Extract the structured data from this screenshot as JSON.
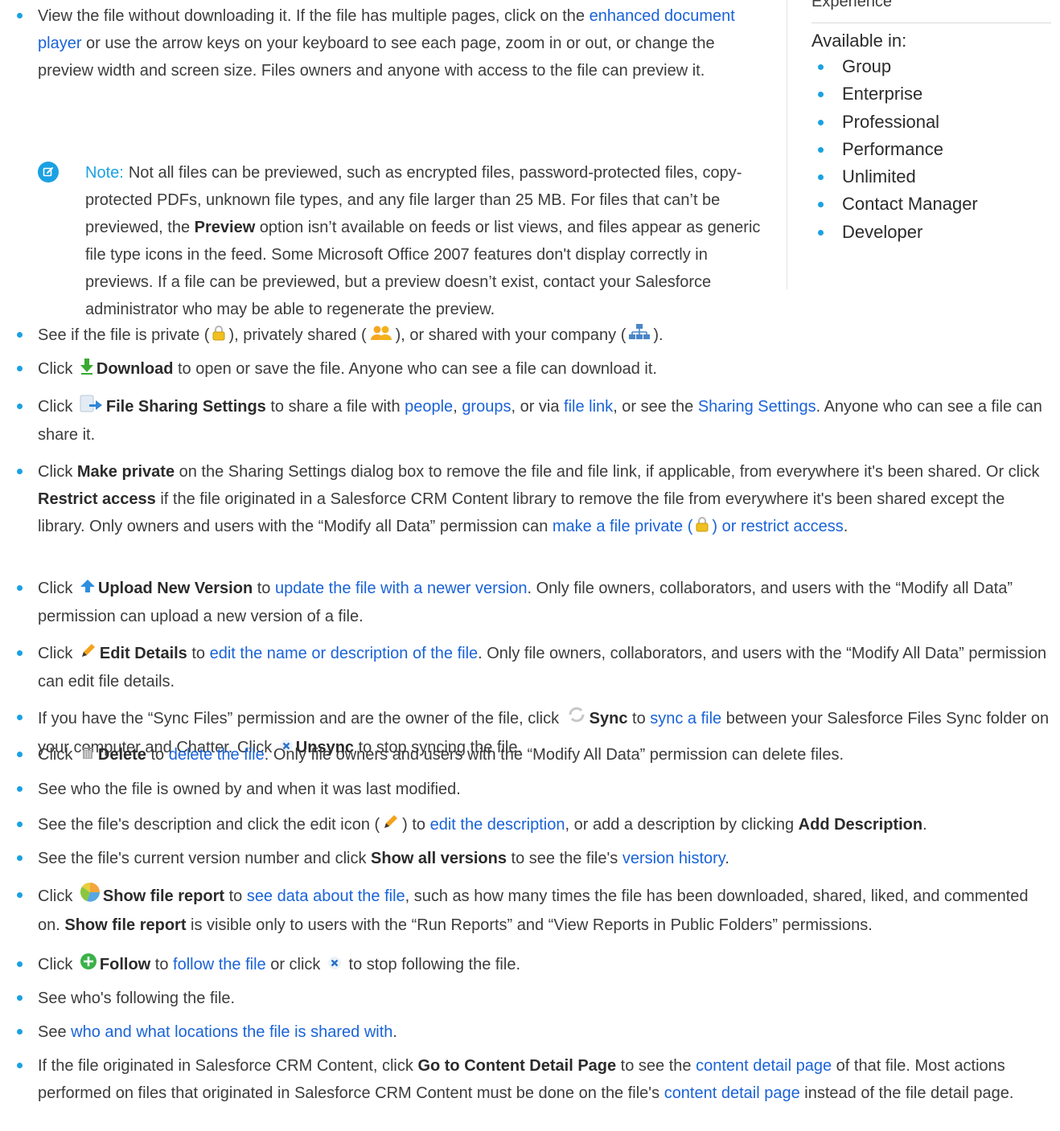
{
  "sidebar": {
    "title": "Experience",
    "available_label": "Available in:",
    "editions": [
      "Group",
      "Enterprise",
      "Professional",
      "Performance",
      "Unlimited",
      "Contact Manager",
      "Developer"
    ]
  },
  "items": {
    "view": {
      "t1": "View the file without downloading it. If the file has multiple pages, click on the ",
      "link1": "enhanced document player",
      "t2": " or use the arrow keys on your keyboard to see each page, zoom in or out, or change the preview width and screen size. Files owners and anyone with access to the file can preview it."
    },
    "note": {
      "label": "Note:",
      "t1": "Not all files can be previewed, such as encrypted files, password-protected files, copy-protected PDFs, unknown file types, and any file larger than 25 MB. For files that can’t be previewed, the ",
      "b1": "Preview",
      "t2": " option isn’t available on feeds or list views, and files appear as generic file type icons in the feed. Some Microsoft Office 2007 features don't display correctly in previews. If a file can be previewed, but a preview doesn’t exist, contact your Salesforce administrator who may be able to regenerate the preview."
    },
    "private": {
      "t1": "See if the file is private (",
      "t2": "), privately shared (",
      "t3": "), or shared with your company (",
      "t4": ")."
    },
    "download": {
      "t1": "Click ",
      "b1": "Download",
      "t2": " to open or save the file. Anyone who can see a file can download it."
    },
    "sharing": {
      "t1": "Click ",
      "b1": "File Sharing Settings",
      "t2": " to share a file with ",
      "l1": "people",
      "t3": ", ",
      "l2": "groups",
      "t4": ", or via ",
      "l3": "file link",
      "t5": ", or see the ",
      "l4": "Sharing Settings",
      "t6": ". Anyone who can see a file can share it."
    },
    "makeprivate": {
      "t1": "Click ",
      "b1": "Make private",
      "t2": " on the Sharing Settings dialog box to remove the file and file link, if applicable, from everywhere it's been shared. Or click ",
      "b2": "Restrict access",
      "t3": " if the file originated in a Salesforce CRM Content library to remove the file from everywhere it's been shared except the library. Only owners and users with the “Modify all Data” permission can ",
      "l1": "make a file private (",
      "l2": ") or restrict access",
      "t4": "."
    },
    "upload": {
      "t1": "Click ",
      "b1": "Upload New Version",
      "t2": " to ",
      "l1": "update the file with a newer version",
      "t3": ". Only file owners, collaborators, and users with the “Modify all Data” permission can upload a new version of a file."
    },
    "edit": {
      "t1": "Click ",
      "b1": "Edit Details",
      "t2": " to ",
      "l1": "edit the name or description of the file",
      "t3": ". Only file owners, collaborators, and users with the “Modify All Data” permission can edit file details."
    },
    "sync": {
      "t1": "If you have the “Sync Files” permission and are the owner of the file, click ",
      "b1": "Sync",
      "t2": " to ",
      "l1": "sync a file",
      "t3": " between your Salesforce Files Sync folder on your computer and Chatter. Click ",
      "b2": "Unsync",
      "t4": " to stop syncing the file."
    },
    "delete": {
      "t1": "Click ",
      "b1": "Delete",
      "t2": " to ",
      "l1": "delete the file",
      "t3": ". Only file owners and users with the “Modify All Data” permission can delete files."
    },
    "owned": {
      "t1": "See who the file is owned by and when it was last modified."
    },
    "desc": {
      "t1": "See the file's description and click the edit icon (",
      "t2": ") to ",
      "l1": "edit the description",
      "t3": ", or add a description by clicking ",
      "b1": "Add Description",
      "t4": "."
    },
    "version": {
      "t1": "See the file's current version number and click ",
      "b1": "Show all versions",
      "t2": " to see the file's ",
      "l1": "version history",
      "t3": "."
    },
    "report": {
      "t1": "Click ",
      "b1": "Show file report",
      "t2": " to ",
      "l1": "see data about the file",
      "t3": ", such as how many times the file has been downloaded, shared, liked, and commented on. ",
      "b2": "Show file report",
      "t4": " is visible only to users with the “Run Reports” and “View Reports in Public Folders” permissions."
    },
    "follow": {
      "t1": "Click ",
      "b1": "Follow",
      "t2": " to ",
      "l1": "follow the file",
      "t3": " or click ",
      "t4": " to stop following the file."
    },
    "following": {
      "t1": "See who's following the file."
    },
    "shared": {
      "t1": "See ",
      "l1": "who and what locations the file is shared with",
      "t2": "."
    },
    "content": {
      "t1": "If the file originated in Salesforce CRM Content, click ",
      "b1": "Go to Content Detail Page",
      "t2": " to see the ",
      "l1": "content detail page",
      "t3": " of that file. Most actions performed on files that originated in Salesforce CRM Content must be done on the file's ",
      "l2": "content detail page",
      "t4": " instead of the file detail page."
    }
  }
}
